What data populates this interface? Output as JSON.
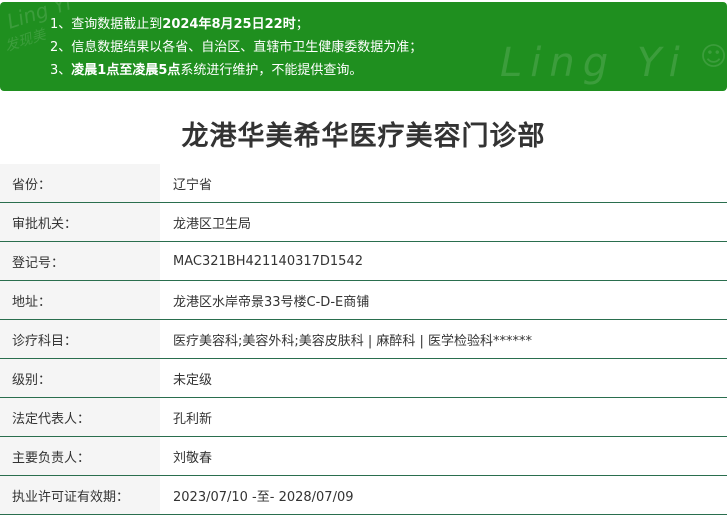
{
  "notice": {
    "watermark": "Ling Yi",
    "watermark_sub": "发现美",
    "items": [
      {
        "prefix": "1、查询数据截止到",
        "bold": "2024年8月25日22时",
        "suffix": "；"
      },
      {
        "prefix": "2、信息数据结果以各省、自治区、直辖市卫生健康委数据为准；",
        "bold": "",
        "suffix": ""
      },
      {
        "prefix": "3、",
        "bold": "凌晨1点至凌晨5点",
        "suffix": "系统进行维护，不能提供查询。"
      }
    ]
  },
  "title": "龙港华美希华医疗美容门诊部",
  "rows": [
    {
      "label": "省份：",
      "value": "辽宁省"
    },
    {
      "label": "审批机关：",
      "value": "龙港区卫生局"
    },
    {
      "label": "登记号：",
      "value": "MAC321BH421140317D1542"
    },
    {
      "label": "地址：",
      "value": "龙港区水岸帝景33号楼C-D-E商铺"
    },
    {
      "label": "诊疗科目：",
      "value": "医疗美容科;美容外科;美容皮肤科 | 麻醉科 | 医学检验科******"
    },
    {
      "label": "级别：",
      "value": "未定级"
    },
    {
      "label": "法定代表人：",
      "value": "孔利新"
    },
    {
      "label": "主要负责人：",
      "value": "刘敬春"
    },
    {
      "label": "执业许可证有效期：",
      "value": "2023/07/10 -至- 2028/07/09"
    }
  ],
  "colors": {
    "banner": "#1f8f1f",
    "row_border": "#2a6e4e",
    "label_bg": "#f5f5f5"
  }
}
